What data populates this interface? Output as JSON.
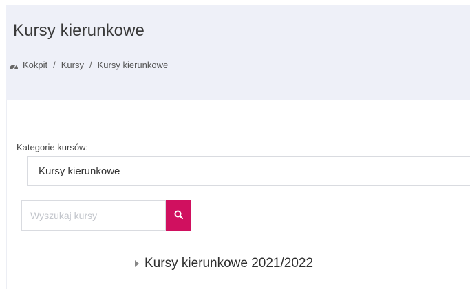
{
  "header": {
    "title": "Kursy kierunkowe",
    "breadcrumb": [
      {
        "label": "Kokpit"
      },
      {
        "label": "Kursy"
      },
      {
        "label": "Kursy kierunkowe"
      }
    ],
    "separator": "/"
  },
  "filters": {
    "category_label": "Kategorie kursów:",
    "category_selected": "Kursy kierunkowe",
    "search_placeholder": "Wyszukaj kursy"
  },
  "category_tree": [
    {
      "label": "Kursy kierunkowe 2021/2022",
      "expanded": false
    }
  ],
  "colors": {
    "accent": "#d0105f",
    "header_bg": "#eef0f8"
  },
  "icons": {
    "breadcrumb_home": "dashboard-icon",
    "search": "search-icon",
    "collapse": "caret-right-icon"
  }
}
